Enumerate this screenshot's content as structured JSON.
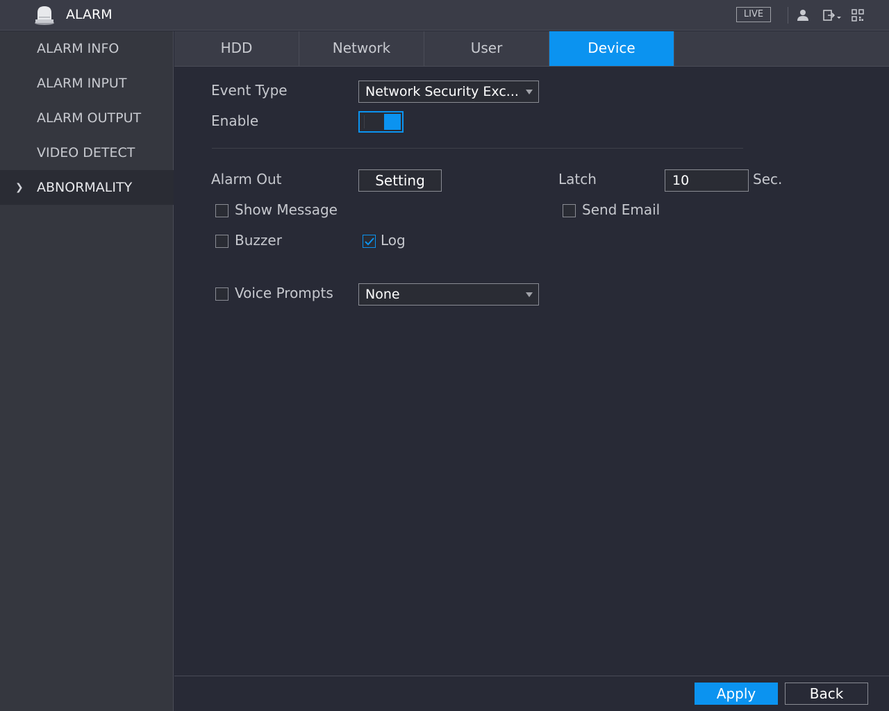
{
  "header": {
    "title": "ALARM",
    "live_label": "LIVE",
    "icons": [
      "alarm-bell-icon",
      "user-icon",
      "logout-icon",
      "qr-code-icon"
    ]
  },
  "sidebar": {
    "items": [
      {
        "label": "ALARM INFO"
      },
      {
        "label": "ALARM INPUT"
      },
      {
        "label": "ALARM OUTPUT"
      },
      {
        "label": "VIDEO DETECT"
      },
      {
        "label": "ABNORMALITY",
        "active": true
      }
    ]
  },
  "tabs": [
    {
      "label": "HDD"
    },
    {
      "label": "Network"
    },
    {
      "label": "User"
    },
    {
      "label": "Device",
      "active": true
    }
  ],
  "form": {
    "event_type_label": "Event Type",
    "event_type_value": "Network Security Exc...",
    "enable_label": "Enable",
    "enable_on": true,
    "alarm_out_label": "Alarm Out",
    "setting_label": "Setting",
    "latch_label": "Latch",
    "latch_value": "10",
    "latch_unit": "Sec.",
    "show_message_label": "Show Message",
    "show_message_checked": false,
    "send_email_label": "Send Email",
    "send_email_checked": false,
    "buzzer_label": "Buzzer",
    "buzzer_checked": false,
    "log_label": "Log",
    "log_checked": true,
    "voice_prompts_label": "Voice Prompts",
    "voice_prompts_checked": false,
    "voice_prompts_value": "None"
  },
  "footer": {
    "apply_label": "Apply",
    "back_label": "Back"
  },
  "colors": {
    "accent": "#0b93f0",
    "background": "#282a36",
    "panel": "#3a3c47"
  }
}
